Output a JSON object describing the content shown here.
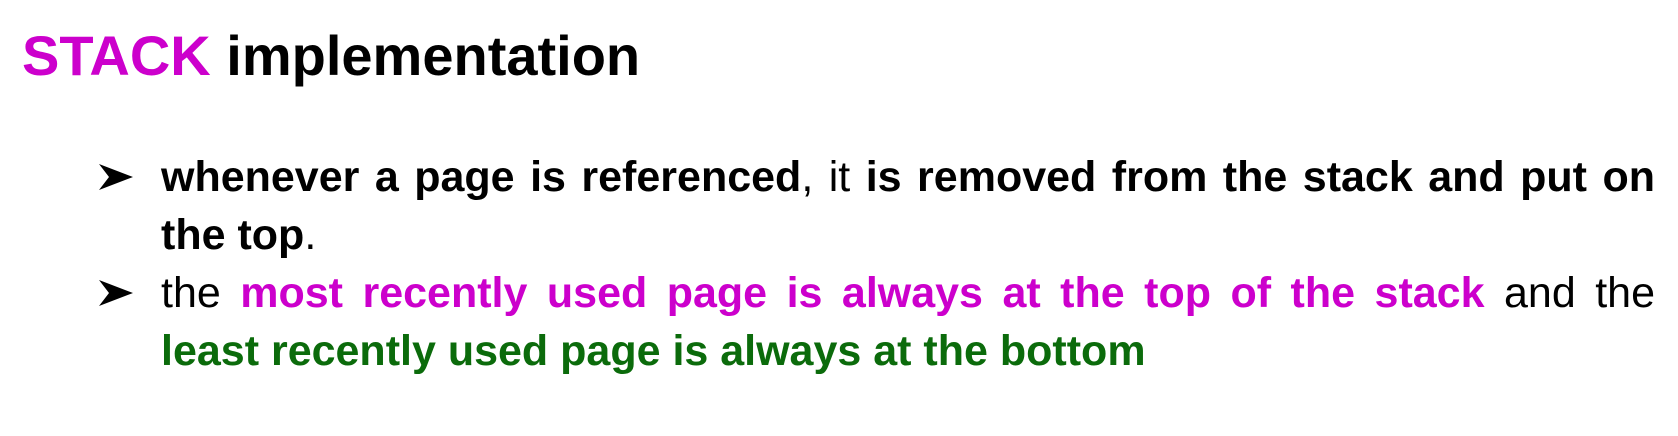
{
  "title": {
    "accent": "STACK",
    "rest": " implementation"
  },
  "bullets": [
    {
      "parts": [
        "whenever a page is referenced",
        ", it ",
        "is removed from the stack and put on the top",
        "."
      ]
    },
    {
      "parts": [
        "the ",
        "most recently used page is always at the top of the stack",
        " and the ",
        "least recently used page is always at the bottom"
      ]
    }
  ],
  "colors": {
    "accent": "#cc00cc",
    "green": "#0b6b0b",
    "text": "#000000"
  },
  "icons": {
    "bullet": "arrowhead-bullet-icon"
  }
}
